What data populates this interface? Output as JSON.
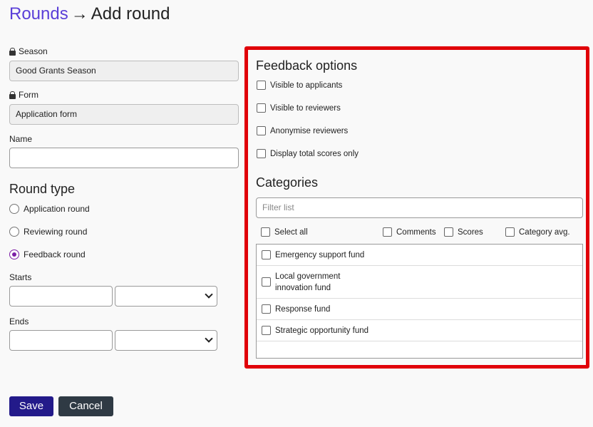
{
  "breadcrumb": {
    "parent": "Rounds",
    "arrow": "→",
    "current": "Add round"
  },
  "season": {
    "label": "Season",
    "value": "Good Grants Season"
  },
  "form": {
    "label": "Form",
    "value": "Application form"
  },
  "name": {
    "label": "Name",
    "value": ""
  },
  "round_type": {
    "title": "Round type",
    "options": [
      {
        "label": "Application round",
        "selected": false
      },
      {
        "label": "Reviewing round",
        "selected": false
      },
      {
        "label": "Feedback round",
        "selected": true
      }
    ]
  },
  "starts": {
    "label": "Starts"
  },
  "ends": {
    "label": "Ends"
  },
  "feedback_options": {
    "title": "Feedback options",
    "items": [
      "Visible to applicants",
      "Visible to reviewers",
      "Anonymise reviewers",
      "Display total scores only"
    ]
  },
  "categories": {
    "title": "Categories",
    "filter_placeholder": "Filter list",
    "select_all": "Select all",
    "columns": [
      "Comments",
      "Scores",
      "Category avg."
    ],
    "items": [
      "Emergency support fund",
      "Local government innovation fund",
      "Response fund",
      "Strategic opportunity fund"
    ],
    "items_lines": [
      [
        "Emergency support fund"
      ],
      [
        "Local government",
        "innovation fund"
      ],
      [
        "Response fund"
      ],
      [
        "Strategic opportunity fund"
      ]
    ]
  },
  "actions": {
    "save": "Save",
    "cancel": "Cancel"
  },
  "colors": {
    "accent": "#231a8a",
    "link": "#5a3fd8",
    "highlight": "#e00008",
    "radio": "#7c1fa6"
  }
}
